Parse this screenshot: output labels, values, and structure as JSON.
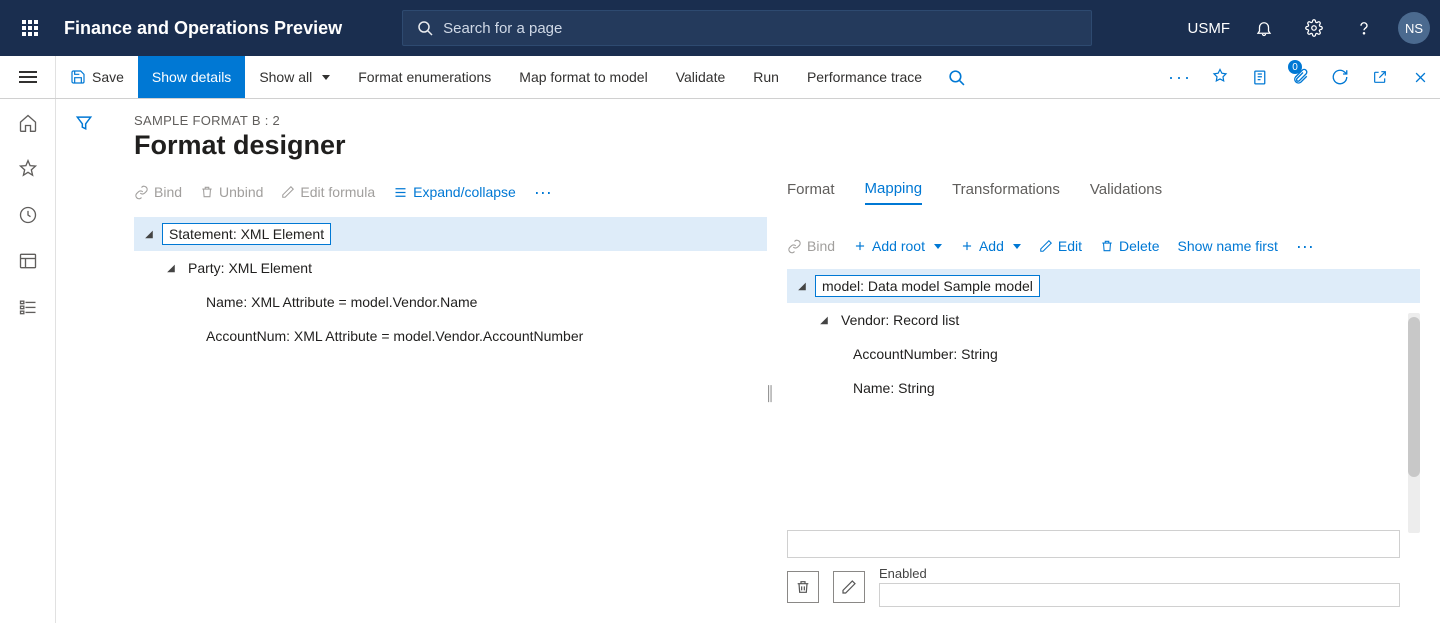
{
  "header": {
    "app_title": "Finance and Operations Preview",
    "search_placeholder": "Search for a page",
    "company": "USMF",
    "avatar_initials": "NS"
  },
  "action_bar": {
    "save": "Save",
    "show_details": "Show details",
    "show_all": "Show all",
    "format_enumerations": "Format enumerations",
    "map_format": "Map format to model",
    "validate": "Validate",
    "run": "Run",
    "performance_trace": "Performance trace",
    "pin_count": "0"
  },
  "page": {
    "breadcrumb": "SAMPLE FORMAT B : 2",
    "title": "Format designer"
  },
  "left_toolbar": {
    "bind": "Bind",
    "unbind": "Unbind",
    "edit_formula": "Edit formula",
    "expand_collapse": "Expand/collapse"
  },
  "right_tabs": {
    "format": "Format",
    "mapping": "Mapping",
    "transformations": "Transformations",
    "validations": "Validations"
  },
  "right_toolbar": {
    "bind": "Bind",
    "add_root": "Add root",
    "add": "Add",
    "edit": "Edit",
    "delete": "Delete",
    "show_name_first": "Show name first"
  },
  "format_tree": {
    "root": "Statement: XML Element",
    "party": "Party: XML Element",
    "name_attr": "Name: XML Attribute = model.Vendor.Name",
    "account_attr": "AccountNum: XML Attribute = model.Vendor.AccountNumber"
  },
  "mapping_tree": {
    "root": "model: Data model Sample model",
    "vendor": "Vendor: Record list",
    "account": "AccountNumber: String",
    "name": "Name: String"
  },
  "props": {
    "enabled": "Enabled"
  }
}
